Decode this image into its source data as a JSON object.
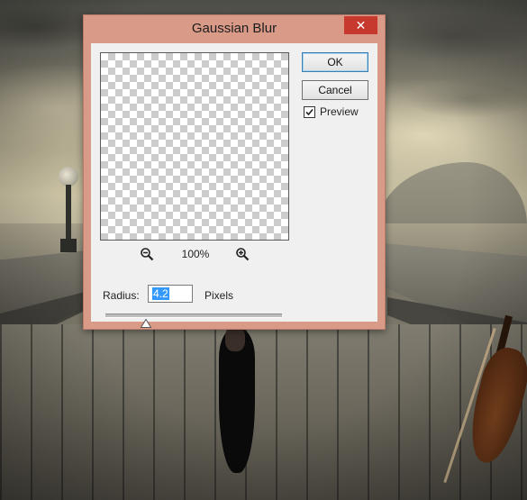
{
  "dialog": {
    "title": "Gaussian Blur",
    "close_glyph": "✕",
    "ok_label": "OK",
    "cancel_label": "Cancel",
    "preview_label": "Preview",
    "preview_checked": true,
    "zoom_level": "100%",
    "zoom_out_icon": "zoom-out-icon",
    "zoom_in_icon": "zoom-in-icon",
    "radius_label": "Radius:",
    "radius_value": "4.2",
    "radius_unit": "Pixels",
    "radius_slider_fraction": 0.23
  },
  "colors": {
    "titlebar": "#d99a88",
    "close_button": "#c7392f",
    "client": "#f0f0f0",
    "selection": "#3399ff"
  }
}
